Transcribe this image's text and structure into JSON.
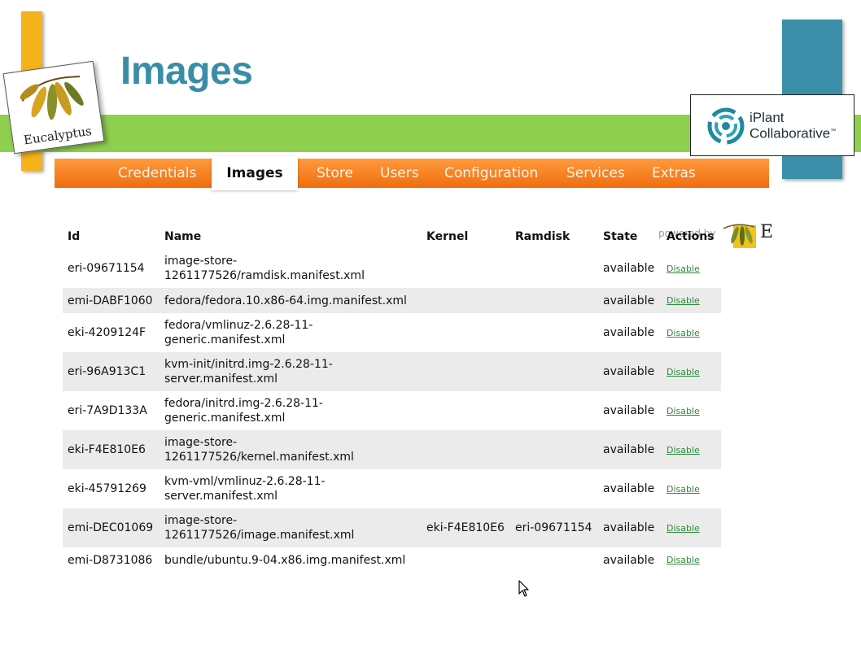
{
  "slide": {
    "title": "Images",
    "logo_left_text": "Eucalyptus",
    "logo_right_line1": "iPlant",
    "logo_right_line2": "Collaborative",
    "logo_right_tm": "™"
  },
  "nav": {
    "items": [
      {
        "label": "Credentials",
        "active": false
      },
      {
        "label": "Images",
        "active": true
      },
      {
        "label": "Store",
        "active": false
      },
      {
        "label": "Users",
        "active": false
      },
      {
        "label": "Configuration",
        "active": false
      },
      {
        "label": "Services",
        "active": false
      },
      {
        "label": "Extras",
        "active": false
      }
    ]
  },
  "powered_by": {
    "text": "powered by",
    "brand_initial": "E"
  },
  "table": {
    "headers": [
      "Id",
      "Name",
      "Kernel",
      "Ramdisk",
      "State",
      "Actions"
    ],
    "rows": [
      {
        "id": "eri-09671154",
        "name": [
          "image-store-",
          "1261177526/ramdisk.manifest.xml"
        ],
        "kernel": "",
        "ramdisk": "",
        "state": "available",
        "action": "Disable"
      },
      {
        "id": "emi-DABF1060",
        "name": [
          "fedora/fedora.10.x86-64.img.manifest.xml"
        ],
        "kernel": "",
        "ramdisk": "",
        "state": "available",
        "action": "Disable"
      },
      {
        "id": "eki-4209124F",
        "name": [
          "fedora/vmlinuz-2.6.28-11-",
          "generic.manifest.xml"
        ],
        "kernel": "",
        "ramdisk": "",
        "state": "available",
        "action": "Disable"
      },
      {
        "id": "eri-96A913C1",
        "name": [
          "kvm-init/initrd.img-2.6.28-11-",
          "server.manifest.xml"
        ],
        "kernel": "",
        "ramdisk": "",
        "state": "available",
        "action": "Disable"
      },
      {
        "id": "eri-7A9D133A",
        "name": [
          "fedora/initrd.img-2.6.28-11-",
          "generic.manifest.xml"
        ],
        "kernel": "",
        "ramdisk": "",
        "state": "available",
        "action": "Disable"
      },
      {
        "id": "eki-F4E810E6",
        "name": [
          "image-store-",
          "1261177526/kernel.manifest.xml"
        ],
        "kernel": "",
        "ramdisk": "",
        "state": "available",
        "action": "Disable"
      },
      {
        "id": "eki-45791269",
        "name": [
          "kvm-vml/vmlinuz-2.6.28-11-",
          "server.manifest.xml"
        ],
        "kernel": "",
        "ramdisk": "",
        "state": "available",
        "action": "Disable"
      },
      {
        "id": "emi-DEC01069",
        "name": [
          "image-store-",
          "1261177526/image.manifest.xml"
        ],
        "kernel": "eki-F4E810E6",
        "ramdisk": "eri-09671154",
        "state": "available",
        "action": "Disable"
      },
      {
        "id": "emi-D8731086",
        "name": [
          "bundle/ubuntu.9-04.x86.img.manifest.xml"
        ],
        "kernel": "",
        "ramdisk": "",
        "state": "available",
        "action": "Disable"
      }
    ]
  },
  "colors": {
    "title": "#3a8da8",
    "nav_orange": "#ef6d10",
    "green_band": "#8fcf4f",
    "teal_block": "#3b8fa8",
    "orange_block": "#f5b21a",
    "link_green": "#2e8a3a"
  },
  "icons": {
    "left_logo": "eucalyptus-leaves-icon",
    "right_logo": "iplant-swirl-icon",
    "cursor": "mouse-pointer-icon"
  }
}
